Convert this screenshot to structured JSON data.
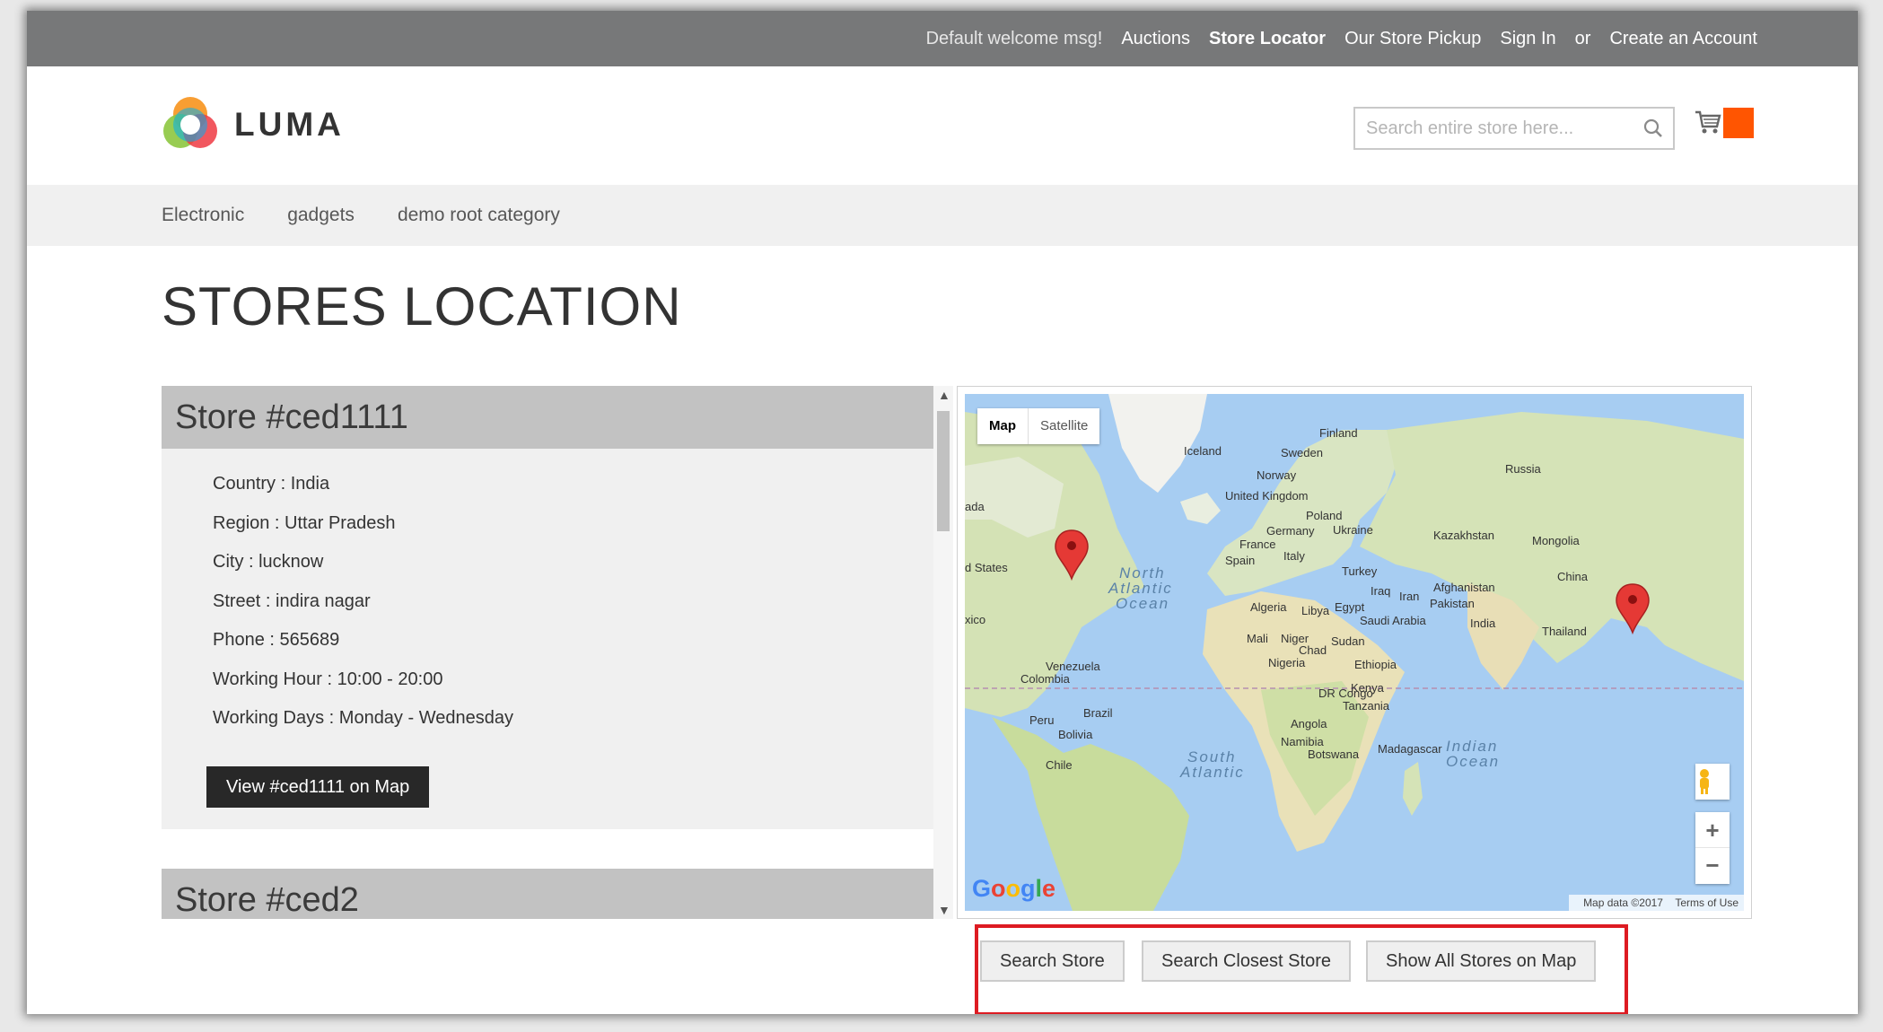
{
  "topbar": {
    "welcome": "Default welcome msg!",
    "links": [
      "Auctions",
      "Store Locator",
      "Our Store Pickup",
      "Sign In",
      "or",
      "Create an Account"
    ]
  },
  "header": {
    "logo_text": "LUMA",
    "search_placeholder": "Search entire store here..."
  },
  "nav": {
    "items": [
      "Electronic",
      "gadgets",
      "demo root category"
    ]
  },
  "page": {
    "title": "STORES LOCATION"
  },
  "stores": [
    {
      "title": "Store #ced1111",
      "details": [
        "Country : India",
        "Region : Uttar Pradesh",
        "City : lucknow",
        "Street : indira nagar",
        "Phone : 565689",
        "Working Hour : 10:00 - 20:00",
        "Working Days : Monday - Wednesday"
      ],
      "button": "View #ced1111 on Map"
    },
    {
      "title": "Store #ced2"
    }
  ],
  "map": {
    "type_map": "Map",
    "type_satellite": "Satellite",
    "labels": {
      "finland": "Finland",
      "sweden": "Sweden",
      "iceland": "Iceland",
      "norway": "Norway",
      "russia": "Russia",
      "uk": "United Kingdom",
      "poland": "Poland",
      "germany": "Germany",
      "ukraine": "Ukraine",
      "kazakhstan": "Kazakhstan",
      "mongolia": "Mongolia",
      "france": "France",
      "spain": "Spain",
      "italy": "Italy",
      "turkey": "Turkey",
      "china": "China",
      "afghanistan": "Afghanistan",
      "iraq": "Iraq",
      "iran": "Iran",
      "pakistan": "Pakistan",
      "india": "India",
      "thailand": "Thailand",
      "algeria": "Algeria",
      "libya": "Libya",
      "egypt": "Egypt",
      "saudi": "Saudi Arabia",
      "mali": "Mali",
      "niger": "Niger",
      "chad": "Chad",
      "sudan": "Sudan",
      "nigeria": "Nigeria",
      "ethiopia": "Ethiopia",
      "drc": "DR Congo",
      "kenya": "Kenya",
      "tanzania": "Tanzania",
      "angola": "Angola",
      "namibia": "Namibia",
      "botswana": "Botswana",
      "madagascar": "Madagascar",
      "venezuela": "Venezuela",
      "colombia": "Colombia",
      "brazil": "Brazil",
      "peru": "Peru",
      "bolivia": "Bolivia",
      "chile": "Chile",
      "canada_part": "ada",
      "us_part": "d States",
      "mexico_part": "xico",
      "north_atlantic": [
        "North",
        "Atlantic",
        "Ocean"
      ],
      "south_atlantic": [
        "South",
        "Atlantic"
      ],
      "indian_ocean": [
        "Indian",
        "Ocean"
      ]
    },
    "google": "Google",
    "attribution": "Map data ©2017",
    "terms": "Terms of Use"
  },
  "actions": [
    "Search Store",
    "Search Closest Store",
    "Show All Stores on Map"
  ],
  "colors": {
    "accent": "#ff5501",
    "highlight": "#dd1b22",
    "topbar": "#777879"
  }
}
